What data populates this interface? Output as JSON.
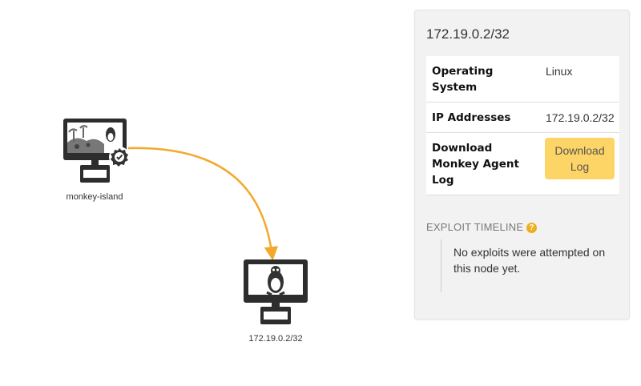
{
  "map": {
    "nodes": [
      {
        "label": "monkey-island",
        "icon": "monitor-island-icon"
      },
      {
        "label": "172.19.0.2/32",
        "icon": "monitor-linux-icon"
      }
    ],
    "edge_color": "#f4a82b"
  },
  "panel": {
    "title": "172.19.0.2/32",
    "rows": [
      {
        "key": "Operating System",
        "value": "Linux"
      },
      {
        "key": "IP Addresses",
        "value": "172.19.0.2/32"
      },
      {
        "key": "Download Monkey Agent Log",
        "button": "Download Log"
      }
    ],
    "timeline": {
      "title": "EXPLOIT TIMELINE",
      "help_icon": "?",
      "message": "No exploits were attempted on this node yet."
    }
  },
  "colors": {
    "accent": "#fdd466",
    "help": "#f0ad1e",
    "edge": "#f4a82b"
  }
}
